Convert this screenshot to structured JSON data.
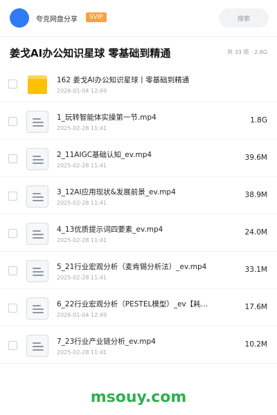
{
  "header": {
    "app_name": "夸克网盘分享",
    "badge": "SVIP",
    "search_placeholder": "搜索",
    "avatar_color": "#2f7bf5"
  },
  "share": {
    "title": "姜戈AI办公知识星球 零基础到精通",
    "summary": "共 33 项 · 2.6G"
  },
  "files": [
    {
      "type": "folder-icon",
      "name": "162 姜戈AI办公知识星球丨零基础到精通",
      "date": "2026-01-04 12:49",
      "size": ""
    },
    {
      "type": "document-icon",
      "name": "1_玩转智能体实操第一节.mp4",
      "date": "2025-02-28 11:41",
      "size": "1.8G"
    },
    {
      "type": "document-icon",
      "name": "2_11AIGC基础认知_ev.mp4",
      "date": "2025-02-28 11:41",
      "size": "39.6M"
    },
    {
      "type": "document-icon",
      "name": "3_12AI应用现状&发展前景_ev.mp4",
      "date": "2025-02-28 11:41",
      "size": "38.9M"
    },
    {
      "type": "document-icon",
      "name": "4_13优质提示词四要素_ev.mp4",
      "date": "2025-02-28 11:41",
      "size": "24.0M"
    },
    {
      "type": "document-icon",
      "name": "5_21行业宏观分析（麦肯锡分析法）_ev.mp4",
      "date": "2025-02-28 11:41",
      "size": "33.1M"
    },
    {
      "type": "document-icon",
      "name": "6_22行业宏观分析（PESTEL模型）_ev【耗…",
      "date": "2026-01-04 12:49",
      "size": "17.6M"
    },
    {
      "type": "document-icon",
      "name": "7_23行业产业链分析_ev.mp4",
      "date": "2025-02-28 11:41",
      "size": "10.2M"
    }
  ],
  "watermark": "msouy.com",
  "colors": {
    "accent": "#2f7bf5",
    "svip": "#f7a23a",
    "folder": "#ffc107",
    "watermark": "#2bb24c"
  }
}
